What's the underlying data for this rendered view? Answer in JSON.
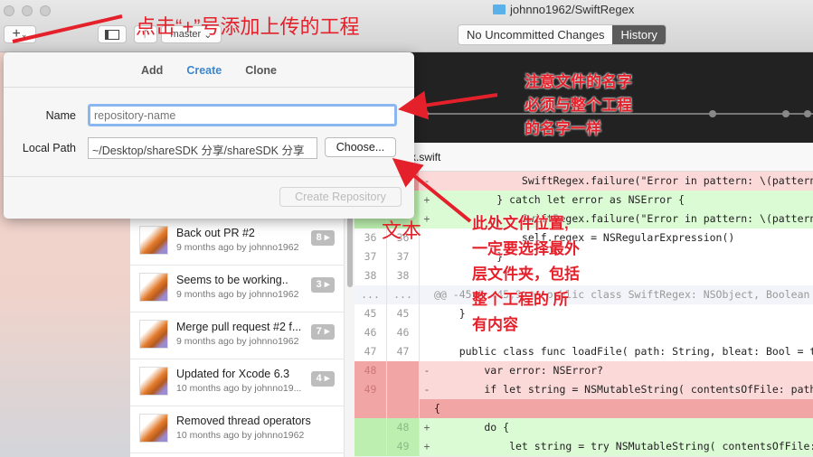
{
  "window": {
    "title": "johnno1962/SwiftRegex",
    "add_button": "+",
    "branch": "master"
  },
  "view_switch": {
    "changes": "No Uncommitted Changes",
    "history": "History",
    "active": "History"
  },
  "dialog": {
    "tabs": [
      "Add",
      "Create",
      "Clone"
    ],
    "active_tab": "Create",
    "name_label": "Name",
    "name_placeholder": "repository-name",
    "name_value": "",
    "path_label": "Local Path",
    "path_value": "~/Desktop/shareSDK 分享/shareSDK 分享",
    "choose_label": "Choose...",
    "create_label": "Create Repository"
  },
  "history": [
    {
      "title": "Back out PR #2",
      "meta": "9 months ago by johnno1962",
      "count": "8"
    },
    {
      "title": "Seems to be working..",
      "meta": "9 months ago by johnno1962",
      "count": "3"
    },
    {
      "title": "Merge pull request #2 f...",
      "meta": "9 months ago by johnno1962",
      "count": "7"
    },
    {
      "title": "Updated for Xcode 6.3",
      "meta": "10 months ago by johnno19...",
      "count": "4"
    },
    {
      "title": "Removed thread operators",
      "meta": "10 months ago by johnno1962",
      "count": ""
    }
  ],
  "file": {
    "name": "x.swift"
  },
  "diff": [
    {
      "type": "del",
      "old": "",
      "new": "",
      "sign": "-",
      "code": "              SwiftRegex.failure(\"Error in pattern: \\(pattern)"
    },
    {
      "type": "add",
      "old": "",
      "new": "",
      "sign": "+",
      "code": "          } catch let error as NSError {"
    },
    {
      "type": "add",
      "old": "",
      "new": "",
      "sign": "+",
      "code": "              SwiftRegex.failure(\"Error in pattern: \\(pattern)"
    },
    {
      "type": "ctx",
      "old": "36",
      "new": "36",
      "sign": "",
      "code": "              self.regex = NSRegularExpression()"
    },
    {
      "type": "ctx",
      "old": "37",
      "new": "37",
      "sign": "",
      "code": "          }"
    },
    {
      "type": "ctx",
      "old": "38",
      "new": "38",
      "sign": "",
      "code": ""
    },
    {
      "type": "hunk",
      "old": "...",
      "new": "...",
      "sign": "",
      "code": "@@ -45,7 +45,9 @@ public class SwiftRegex: NSObject, Boolean"
    },
    {
      "type": "ctx",
      "old": "45",
      "new": "45",
      "sign": "",
      "code": "    }"
    },
    {
      "type": "ctx",
      "old": "46",
      "new": "46",
      "sign": "",
      "code": ""
    },
    {
      "type": "ctx",
      "old": "47",
      "new": "47",
      "sign": "",
      "code": "    public class func loadFile( path: String, bleat: Bool = true"
    },
    {
      "type": "del",
      "old": "48",
      "new": "",
      "sign": "-",
      "code": "        var error: NSError?"
    },
    {
      "type": "del",
      "old": "49",
      "new": "",
      "sign": "-",
      "code": "        if let string = NSMutableString( contentsOfFile: path"
    },
    {
      "type": "delc",
      "old": "",
      "new": "",
      "sign": "",
      "code": "{"
    },
    {
      "type": "add",
      "old": "",
      "new": "48",
      "sign": "+",
      "code": "        do {"
    },
    {
      "type": "add",
      "old": "",
      "new": "49",
      "sign": "+",
      "code": "            let string = try NSMutableString( contentsOfFile:"
    }
  ],
  "annotations": {
    "top": "点击“+”号添加上传的工程",
    "name_note": [
      "注意文件的名字",
      "必须与整个工程",
      "的名字一样"
    ],
    "path_note": [
      "此处文件位置,",
      "一定要选择最外",
      "层文件夹，包括",
      "整个工程的 所",
      "有内容"
    ],
    "text_label": "文本"
  },
  "colors": {
    "accent": "#3b86cf",
    "annotation": "#e4212b",
    "deleted": "#fbd9d9",
    "added": "#dbfbd4"
  }
}
